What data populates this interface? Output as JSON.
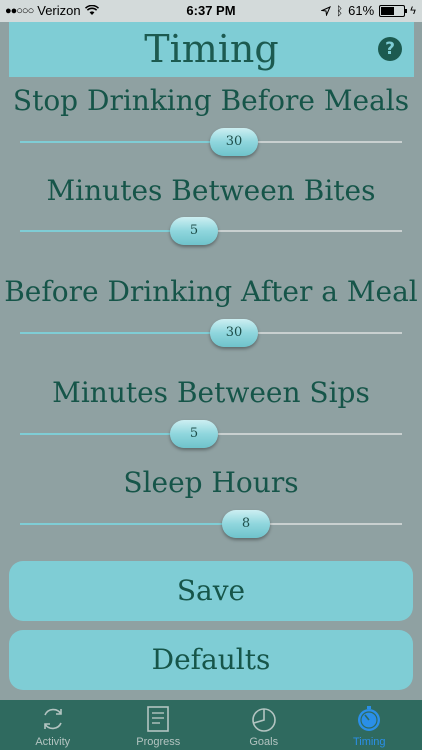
{
  "status_bar": {
    "carrier": "Verizon",
    "time": "6:37 PM",
    "battery": "61%",
    "battery_level": 0.61
  },
  "header": {
    "title": "Timing"
  },
  "settings": [
    {
      "label": "Stop Drinking Before Meals",
      "value": "30"
    },
    {
      "label": "Minutes Between Bites",
      "value": "5"
    },
    {
      "label": "Before Drinking After a Meal",
      "value": "30"
    },
    {
      "label": "Minutes Between Sips",
      "value": "5"
    },
    {
      "label": "Sleep Hours",
      "value": "8"
    }
  ],
  "buttons": {
    "save": "Save",
    "defaults": "Defaults"
  },
  "tabs": [
    {
      "label": "Activity",
      "icon": "activity-icon",
      "active": false
    },
    {
      "label": "Progress",
      "icon": "progress-icon",
      "active": false
    },
    {
      "label": "Goals",
      "icon": "goals-icon",
      "active": false
    },
    {
      "label": "Timing",
      "icon": "timing-icon",
      "active": true
    }
  ],
  "colors": {
    "background": "#8fa1a2",
    "accent": "#7fcdd5",
    "text": "#165549",
    "tab_bar": "#2f6a5f",
    "tab_active": "#2a8fe8"
  }
}
